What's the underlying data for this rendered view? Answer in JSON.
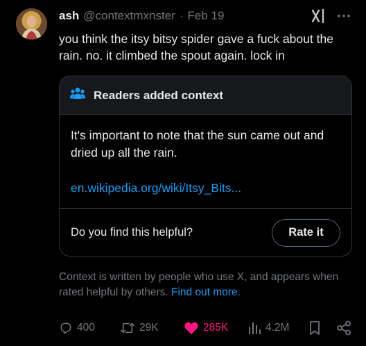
{
  "author": {
    "name": "ash",
    "handle": "@contextmxnster",
    "separator": "·",
    "date": "Feb 19"
  },
  "tweet": {
    "text": "you think the itsy bitsy spider gave a fuck about the rain. no. it climbed the spout again. lock in"
  },
  "community_note": {
    "title": "Readers added context",
    "body": "It's important to note that the sun came out and dried up all the rain.",
    "link": "en.wikipedia.org/wiki/Itsy_Bits...",
    "helpful_question": "Do you find this helpful?",
    "rate_label": "Rate it"
  },
  "disclaimer": {
    "text": "Context is written by people who use X, and appears when rated helpful by others.",
    "link_text": "Find out more."
  },
  "actions": {
    "replies": "400",
    "reposts": "29K",
    "likes": "285K",
    "views": "4.2M"
  },
  "colors": {
    "background": "#000000",
    "text": "#e7e9ea",
    "muted": "#71767b",
    "link": "#1d9bf0",
    "like": "#f91880",
    "border": "#2f3336"
  },
  "icons": {
    "more": "more-icon",
    "grok": "grok-icon",
    "people": "people-icon",
    "reply": "reply-icon",
    "repost": "repost-icon",
    "like": "heart-icon",
    "views": "views-icon",
    "bookmark": "bookmark-icon",
    "share": "share-icon"
  }
}
